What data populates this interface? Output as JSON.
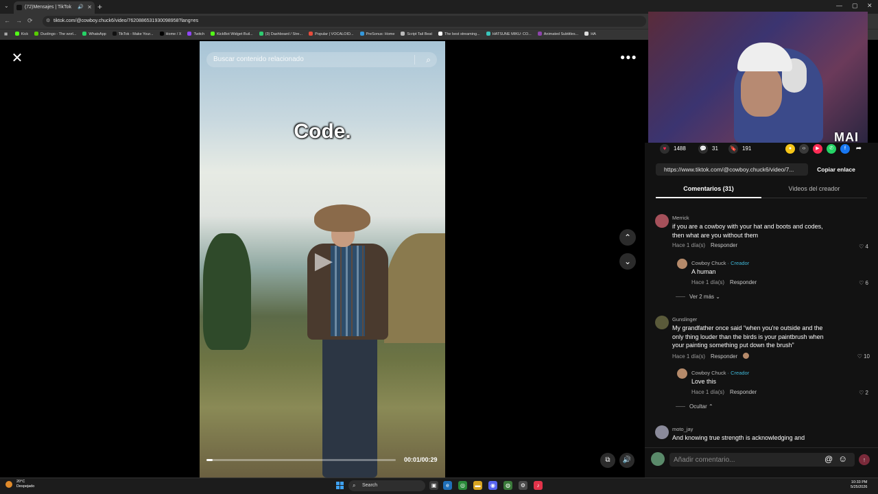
{
  "browser": {
    "tab_title": "(72)Mensajes | TikTok",
    "url": "tiktok.com/@cowboy.chuck6/video/7620886531930098958?lang=es",
    "bookmarks": [
      {
        "label": "Kick",
        "color": "#53fc18"
      },
      {
        "label": "Duolingo - The worl...",
        "color": "#58cc02"
      },
      {
        "label": "WhatsApp",
        "color": "#25d366"
      },
      {
        "label": "TikTok - Make Your...",
        "color": "#111111"
      },
      {
        "label": "Home / X",
        "color": "#000000"
      },
      {
        "label": "Twitch",
        "color": "#9146ff"
      },
      {
        "label": "KickBot Widget Buil...",
        "color": "#53fc18"
      },
      {
        "label": "(3) Dashboard / Stre...",
        "color": "#2ecc71"
      },
      {
        "label": "Popular | VOCALOID...",
        "color": "#e74c3c"
      },
      {
        "label": "PreSonus: Home",
        "color": "#3498db"
      },
      {
        "label": "Script Tail Beat",
        "color": "#bbbbbb"
      },
      {
        "label": "The best streaming...",
        "color": "#ffffff"
      },
      {
        "label": "HATSUNE MIKU: CO...",
        "color": "#39c5bb"
      },
      {
        "label": "Animated Subtitles...",
        "color": "#8e44ad"
      },
      {
        "label": "HA",
        "color": "#dddddd"
      }
    ]
  },
  "video": {
    "search_placeholder": "Buscar contenido relacionado",
    "caption": "Code.",
    "time_display": "00:01/00:29",
    "progress_fraction": 0.034
  },
  "webcam": {
    "overlay_logo": "MAI"
  },
  "stats": {
    "likes": "1488",
    "comments": "31",
    "saves": "191"
  },
  "share": {
    "url": "https://www.tiktok.com/@cowboy.chuck6/video/7...",
    "copy_label": "Copiar enlace",
    "icon_colors": [
      "#f5c518",
      "#3a3a3a",
      "#fe2c55",
      "#25d366",
      "#1877f2",
      "#121212"
    ]
  },
  "panel_tabs": {
    "comments": "Comentarios (31)",
    "creator_videos": "Videos del creador"
  },
  "comments": [
    {
      "user": "Merrick",
      "lines": [
        "if you are a cowboy with your hat and boots and codes,",
        "then what are you without them"
      ],
      "time": "Hace 1 día(s)",
      "reply_label": "Responder",
      "likes": "4",
      "avatar_color": "#a5505a"
    },
    {
      "user": "Cowboy Chuck",
      "creator_tag": "· Creador",
      "lines": [
        "A human"
      ],
      "time": "Hace 1 día(s)",
      "reply_label": "Responder",
      "likes": "6",
      "avatar_color": "#b58a6a"
    },
    {
      "user": "Gunslinger",
      "lines": [
        "My grandfather once said “when you're outside and the",
        "only thing louder than the birds is your paintbrush when",
        "your painting something put down the brush”"
      ],
      "time": "Hace 1 día(s)",
      "reply_label": "Responder",
      "likes": "10",
      "avatar_color": "#5a5a3a"
    },
    {
      "user": "Cowboy Chuck",
      "creator_tag": "· Creador",
      "lines": [
        "Love this"
      ],
      "time": "Hace 1 día(s)",
      "reply_label": "Responder",
      "likes": "2",
      "avatar_color": "#b58a6a"
    },
    {
      "user": "moto_jay",
      "lines": [
        "And knowing true strength is acknowledging and"
      ],
      "avatar_color": "#8a8a9a"
    }
  ],
  "see_more": "Ver 2 más",
  "hide": "Ocultar",
  "comment_input_placeholder": "Añadir comentario...",
  "taskbar": {
    "temp": "20°C",
    "weather": "Despejado",
    "search": "Search",
    "time": "10:33 PM",
    "date": "5/25/2026"
  }
}
